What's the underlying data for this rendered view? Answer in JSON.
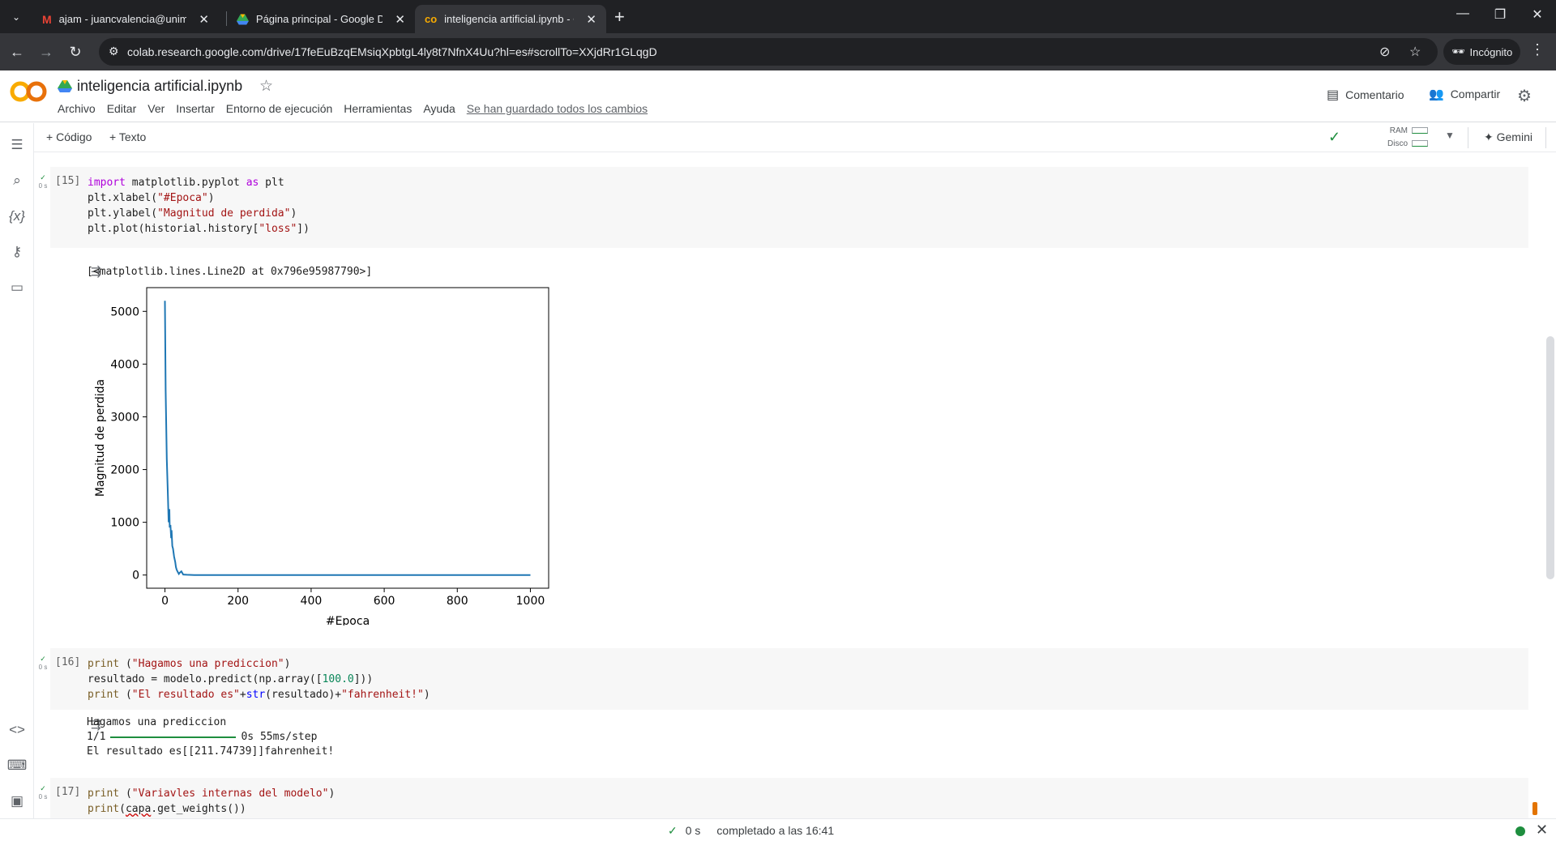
{
  "browser": {
    "tabs": [
      {
        "title": "ajam - juancvalencia@unimayor.edu.co",
        "icon": "gmail-icon",
        "active": false
      },
      {
        "title": "Página principal - Google Drive",
        "icon": "drive-icon",
        "active": false
      },
      {
        "title": "inteligencia artificial.ipynb - Colab",
        "icon": "colab-icon",
        "active": true
      }
    ],
    "url": "colab.research.google.com/drive/17feEuBzqEMsiqXpbtgL4ly8t7NfnX4Uu?hl=es#scrollTo=XXjdRr1GLqgD",
    "incognito_label": "Incógnito"
  },
  "colab": {
    "doc_title": "inteligencia artificial.ipynb",
    "menu": [
      "Archivo",
      "Editar",
      "Ver",
      "Insertar",
      "Entorno de ejecución",
      "Herramientas",
      "Ayuda"
    ],
    "saved_status": "Se han guardado todos los cambios",
    "comment_label": "Comentario",
    "share_label": "Compartir",
    "add_code_label": "Código",
    "add_text_label": "Texto",
    "ram_label": "RAM",
    "disk_label": "Disco",
    "gemini_label": "Gemini"
  },
  "cells": [
    {
      "number": "[15]",
      "time": "0 s",
      "output_text": "[<matplotlib.lines.Line2D at 0x796e95987790>]"
    },
    {
      "number": "[16]",
      "time": "0 s",
      "output_line1": "Hagamos una prediccion",
      "progress_left": "1/1",
      "progress_right": "0s 55ms/step",
      "output_line3": "El resultado es[[211.74739]]fahrenheit!"
    },
    {
      "number": "[17]",
      "time": "0 s"
    }
  ],
  "status": {
    "elapsed": "0 s",
    "message": "completado a las 16:41"
  },
  "chart_data": {
    "type": "line",
    "xlabel": "#Epoca",
    "ylabel": "Magnitud de perdida",
    "xlim": [
      -50,
      1050
    ],
    "ylim": [
      -250,
      5450
    ],
    "xticks": [
      0,
      200,
      400,
      600,
      800,
      1000
    ],
    "yticks": [
      0,
      1000,
      2000,
      3000,
      4000,
      5000
    ],
    "line_color": "#1f77b4",
    "x": [
      0,
      2,
      5,
      8,
      10,
      12,
      13,
      15,
      17,
      18,
      20,
      22,
      25,
      28,
      30,
      32,
      35,
      38,
      40,
      45,
      50,
      60,
      80,
      100,
      200,
      400,
      600,
      800,
      1000
    ],
    "y": [
      5200,
      3500,
      2200,
      1500,
      1000,
      1250,
      900,
      950,
      700,
      850,
      550,
      500,
      350,
      250,
      150,
      100,
      60,
      20,
      40,
      70,
      10,
      5,
      0,
      0,
      0,
      0,
      0,
      0,
      0
    ]
  }
}
